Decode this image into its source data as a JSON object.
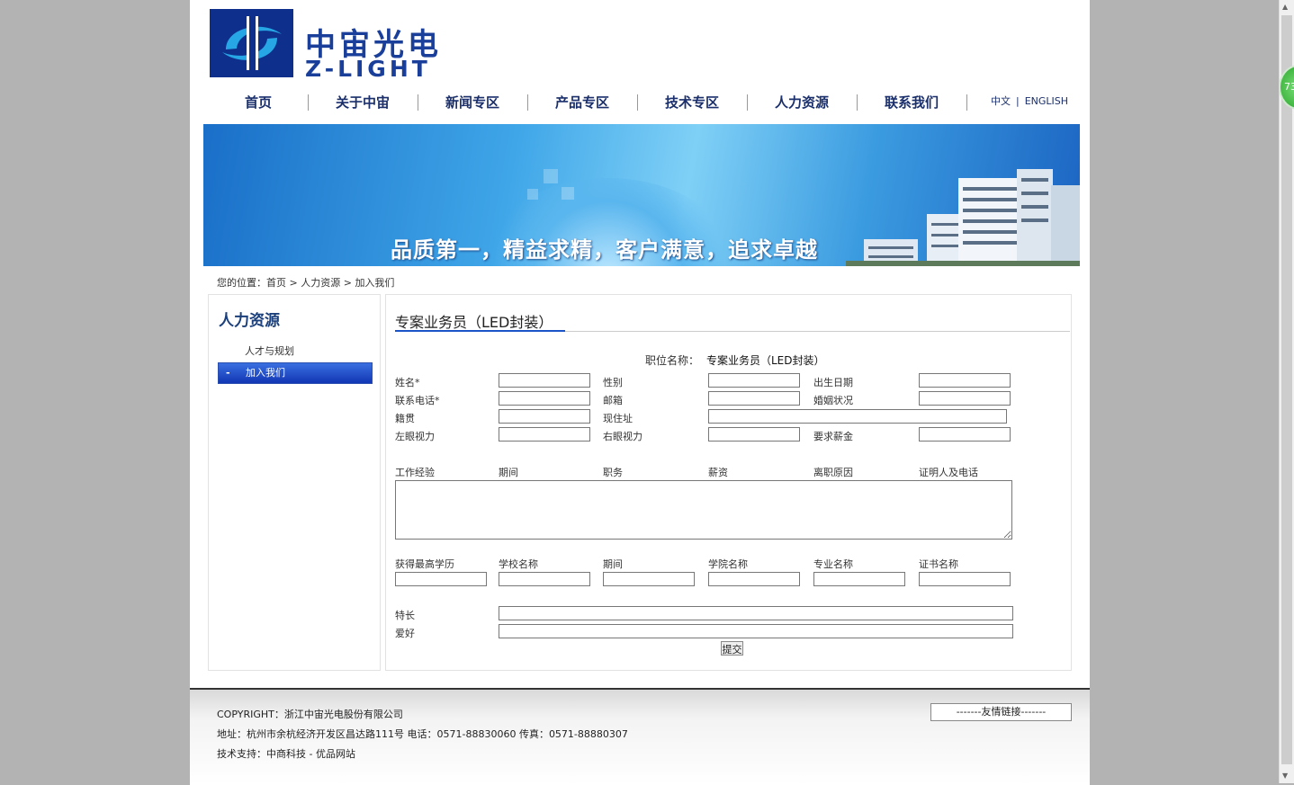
{
  "logo": {
    "cn": "中宙光电",
    "en": "Z-LIGHT"
  },
  "nav": {
    "items": [
      "首页",
      "关于中宙",
      "新闻专区",
      "产品专区",
      "技术专区",
      "人力资源",
      "联系我们"
    ],
    "lang_cn": "中文",
    "lang_sep": "|",
    "lang_en": "ENGLISH"
  },
  "banner": {
    "slogan": "品质第一，精益求精，客户满意，追求卓越"
  },
  "breadcrumb": {
    "prefix": "您的位置：",
    "home": "首页",
    "sep1": " > ",
    "section": "人力资源",
    "sep2": " > ",
    "page": "加入我们"
  },
  "sidebar": {
    "title": "人力资源",
    "items": [
      {
        "label": "人才与规划",
        "active": false
      },
      {
        "label": "加入我们",
        "active": true,
        "marker": "-"
      }
    ]
  },
  "content": {
    "title": "专案业务员（LED封装）",
    "position_label": "职位名称：",
    "position_value": "专案业务员（LED封装）",
    "fields": {
      "name": "姓名*",
      "gender": "性别",
      "birth": "出生日期",
      "phone": "联系电话*",
      "email": "邮箱",
      "marital": "婚姻状况",
      "native": "籍贯",
      "address": "现住址",
      "left_eye": "左眼视力",
      "right_eye": "右眼视力",
      "salary": "要求薪金"
    },
    "work": {
      "label": "工作经验",
      "cols": [
        "期间",
        "职务",
        "薪资",
        "离职原因",
        "证明人及电话"
      ]
    },
    "edu": {
      "cols": [
        "获得最高学历",
        "学校名称",
        "期间",
        "学院名称",
        "专业名称",
        "证书名称"
      ]
    },
    "specialty": "特长",
    "hobby": "爱好",
    "submit": "提交"
  },
  "footer": {
    "copyright": "COPYRIGHT：浙江中宙光电股份有限公司",
    "address": "地址：杭州市余杭经济开发区昌达路111号 电话：0571-88830060 传真：0571-88880307",
    "support": "技术支持：中商科技 - 优品网站",
    "friend_links": "-------友情链接-------"
  },
  "badge": {
    "text": "73"
  }
}
